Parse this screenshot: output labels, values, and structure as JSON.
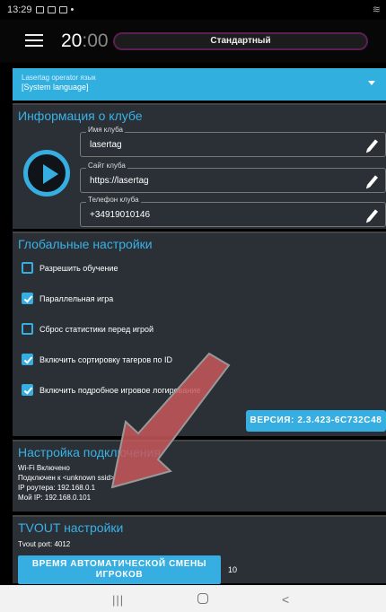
{
  "status_bar": {
    "time": "13:29",
    "icons": [
      "image-icon",
      "cast-icon",
      "mail-icon",
      "dot-icon"
    ],
    "wifi": "wifi-icon"
  },
  "topbar": {
    "time_main": "20",
    "time_dim": ":00",
    "mode": "Стандартный"
  },
  "language": {
    "label": "Lasertag operator язык",
    "value": "[System language]"
  },
  "club_info": {
    "title": "Информация о клубе",
    "fields": [
      {
        "label": "Имя клуба",
        "value": "lasertag"
      },
      {
        "label": "Сайт клуба",
        "value": "https://lasertag"
      },
      {
        "label": "Телефон клуба",
        "value": "+34919010146"
      }
    ]
  },
  "global_settings": {
    "title": "Глобальные настройки",
    "options": [
      {
        "label": "Разрешить обучение",
        "checked": false
      },
      {
        "label": "Параллельная игра",
        "checked": true
      },
      {
        "label": "Сброс статистики перед игрой",
        "checked": false
      },
      {
        "label": "Включить сортировку тагеров по ID",
        "checked": true
      },
      {
        "label": "Включить подробное игровое логирование",
        "checked": true
      }
    ],
    "version_button": "ВЕРСИЯ: 2.3.423-6C732C48"
  },
  "connection": {
    "title": "Настройка подключения",
    "lines": [
      "Wi-Fi Включено",
      "Подключен к <unknown ssid>",
      "IP роутера: 192.168.0.1",
      "Мой IP: 192.168.0.101"
    ]
  },
  "tvout": {
    "title": "TVOUT настройки",
    "port_line": "Tvout port: 4012",
    "button_line1": "ВРЕМЯ АВТОМАТИЧЕСКОЙ СМЕНЫ",
    "button_line2": "ИГРОКОВ",
    "value": "10"
  },
  "nav": {
    "recents": "|||",
    "back": "<"
  },
  "colors": {
    "accent": "#36aee2",
    "panel": "#2a3036",
    "arrow": "#c8585a"
  }
}
